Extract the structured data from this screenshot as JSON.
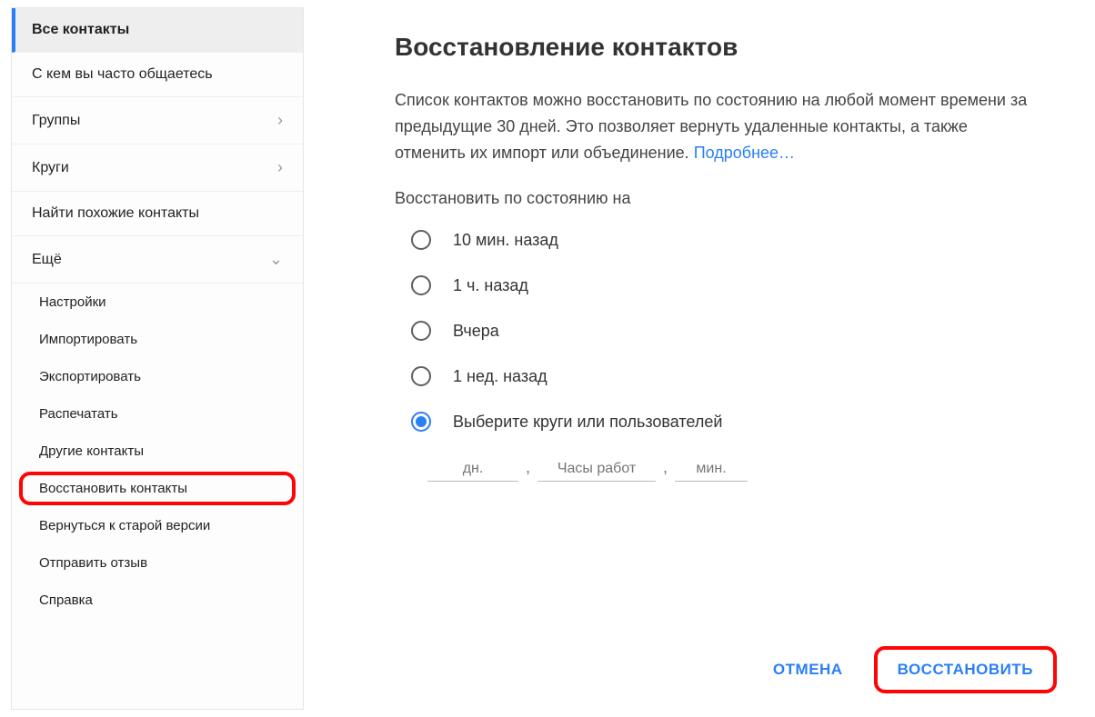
{
  "sidebar": {
    "items": [
      {
        "label": "Все контакты",
        "active": true
      },
      {
        "label": "С кем вы часто общаетесь"
      },
      {
        "label": "Группы",
        "chevron": "right"
      },
      {
        "label": "Круги",
        "chevron": "right"
      },
      {
        "label": "Найти похожие контакты"
      },
      {
        "label": "Ещё",
        "chevron": "down"
      }
    ],
    "sub_items": [
      {
        "label": "Настройки"
      },
      {
        "label": "Импортировать"
      },
      {
        "label": "Экспортировать"
      },
      {
        "label": "Распечатать"
      },
      {
        "label": "Другие контакты"
      },
      {
        "label": "Восстановить контакты",
        "highlight": true
      },
      {
        "label": "Вернуться к старой версии"
      },
      {
        "label": "Отправить отзыв"
      },
      {
        "label": "Справка"
      }
    ]
  },
  "dialog": {
    "title": "Восстановление контактов",
    "description_pre": "Список контактов можно восстановить по состоянию на любой момент времени за предыдущие 30 дней. Это позволяет вернуть удаленные контакты, а также отменить их импорт или объединение. ",
    "more_link": "Подробнее…",
    "restore_to_label": "Восстановить по состоянию на",
    "options": [
      {
        "label": "10 мин. назад",
        "selected": false
      },
      {
        "label": "1 ч. назад",
        "selected": false
      },
      {
        "label": "Вчера",
        "selected": false
      },
      {
        "label": "1 нед. назад",
        "selected": false
      },
      {
        "label": "Выберите круги или пользователей",
        "selected": true
      }
    ],
    "custom": {
      "days_placeholder": "дн.",
      "hours_placeholder": "Часы работ",
      "mins_placeholder": "мин."
    },
    "actions": {
      "cancel": "ОТМЕНА",
      "restore": "ВОССТАНОВИТЬ"
    }
  }
}
